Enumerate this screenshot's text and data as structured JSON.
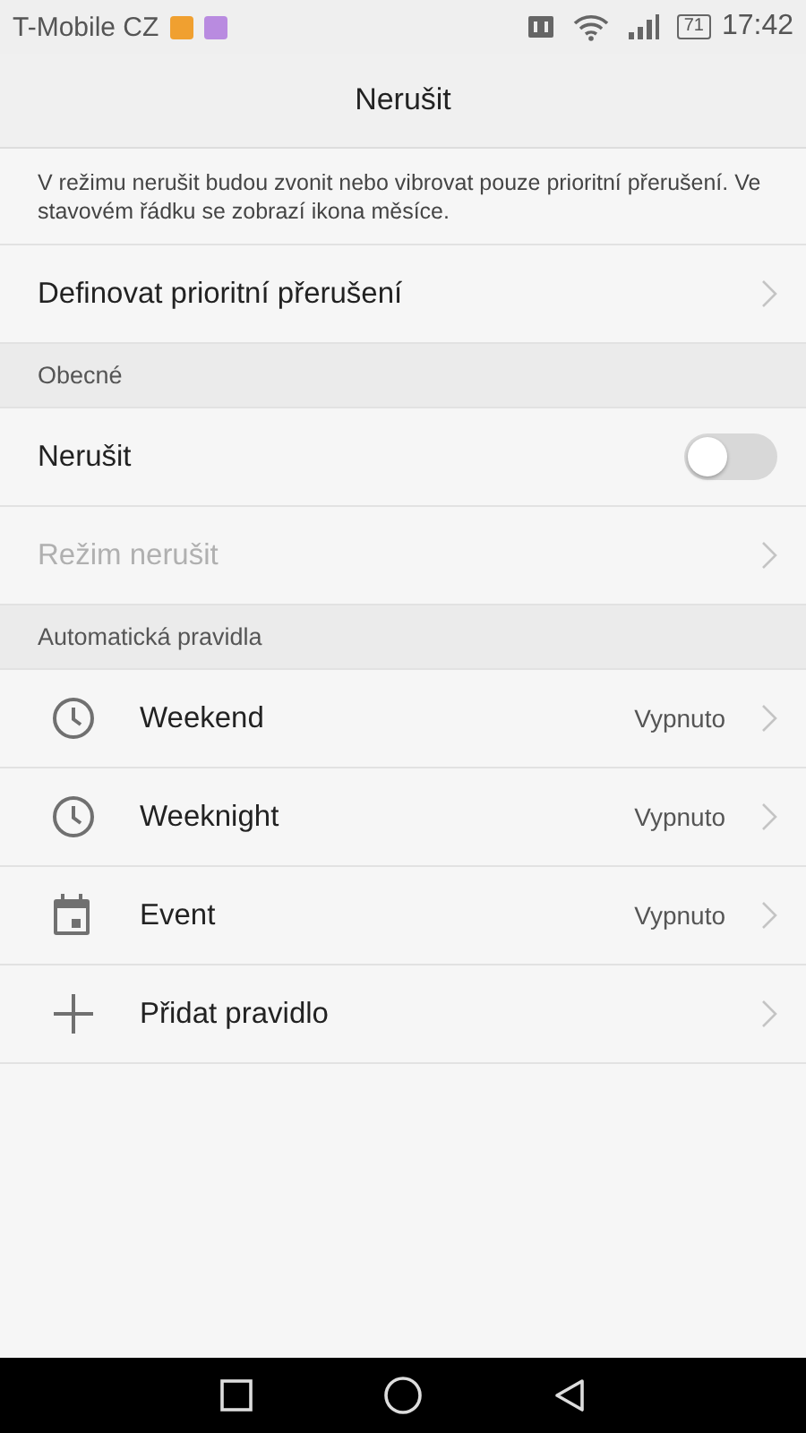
{
  "status_bar": {
    "carrier": "T-Mobile CZ",
    "notifications": [
      {
        "color": "#f0a030"
      },
      {
        "color": "#b98be0"
      }
    ],
    "battery": "71",
    "time": "17:42"
  },
  "title": "Nerušit",
  "description": "V režimu nerušit budou zvonit nebo vibrovat pouze prioritní přerušení. Ve stavovém řádku se zobrazí ikona měsíce.",
  "priority_row": {
    "label": "Definovat prioritní přerušení"
  },
  "general": {
    "header": "Obecné",
    "items": [
      {
        "kind": "toggle",
        "label": "Nerušit",
        "on": false,
        "disabled": false
      },
      {
        "kind": "link",
        "label": "Režim nerušit",
        "disabled": true
      }
    ]
  },
  "rules": {
    "header": "Automatická pravidla",
    "items": [
      {
        "kind": "clock",
        "label": "Weekend",
        "status": "Vypnuto"
      },
      {
        "kind": "clock",
        "label": "Weeknight",
        "status": "Vypnuto"
      },
      {
        "kind": "calendar",
        "label": "Event",
        "status": "Vypnuto"
      },
      {
        "kind": "add",
        "label": "Přidat pravidlo"
      }
    ]
  }
}
